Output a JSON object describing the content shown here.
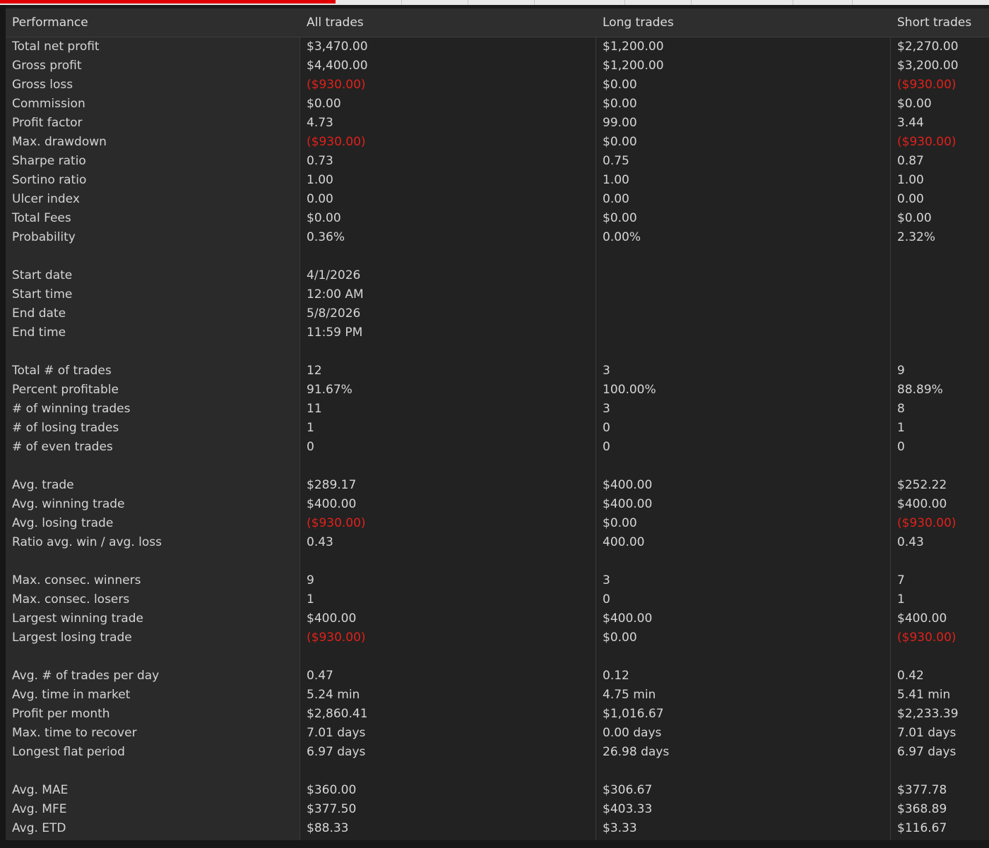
{
  "colors": {
    "background": "#222222",
    "label_column": "#2a2a2a",
    "header": "#2e2e2e",
    "text": "#d6d6d6",
    "negative": "#e0211b",
    "top_accent": "#e00000"
  },
  "header": {
    "label": "Performance",
    "all": "All trades",
    "long": "Long trades",
    "short": "Short trades"
  },
  "rows": [
    {
      "label": "Total net profit",
      "all": "$3,470.00",
      "long": "$1,200.00",
      "short": "$2,270.00"
    },
    {
      "label": "Gross profit",
      "all": "$4,400.00",
      "long": "$1,200.00",
      "short": "$3,200.00"
    },
    {
      "label": "Gross loss",
      "all": "($930.00)",
      "long": "$0.00",
      "short": "($930.00)"
    },
    {
      "label": "Commission",
      "all": "$0.00",
      "long": "$0.00",
      "short": "$0.00"
    },
    {
      "label": "Profit factor",
      "all": "4.73",
      "long": "99.00",
      "short": "3.44"
    },
    {
      "label": "Max. drawdown",
      "all": "($930.00)",
      "long": "$0.00",
      "short": "($930.00)"
    },
    {
      "label": "Sharpe ratio",
      "all": "0.73",
      "long": "0.75",
      "short": "0.87"
    },
    {
      "label": "Sortino ratio",
      "all": "1.00",
      "long": "1.00",
      "short": "1.00"
    },
    {
      "label": "Ulcer index",
      "all": "0.00",
      "long": "0.00",
      "short": "0.00"
    },
    {
      "label": "Total Fees",
      "all": "$0.00",
      "long": "$0.00",
      "short": "$0.00"
    },
    {
      "label": "Probability",
      "all": "0.36%",
      "long": "0.00%",
      "short": "2.32%"
    },
    {
      "gap": true
    },
    {
      "label": "Start date",
      "all": "4/1/2026",
      "long": "",
      "short": ""
    },
    {
      "label": "Start time",
      "all": "12:00 AM",
      "long": "",
      "short": ""
    },
    {
      "label": "End date",
      "all": "5/8/2026",
      "long": "",
      "short": ""
    },
    {
      "label": "End time",
      "all": "11:59 PM",
      "long": "",
      "short": ""
    },
    {
      "gap": true
    },
    {
      "label": "Total # of trades",
      "all": "12",
      "long": "3",
      "short": "9"
    },
    {
      "label": "Percent profitable",
      "all": "91.67%",
      "long": "100.00%",
      "short": "88.89%"
    },
    {
      "label": "# of winning trades",
      "all": "11",
      "long": "3",
      "short": "8"
    },
    {
      "label": "# of losing trades",
      "all": "1",
      "long": "0",
      "short": "1"
    },
    {
      "label": "# of even trades",
      "all": "0",
      "long": "0",
      "short": "0"
    },
    {
      "gap": true
    },
    {
      "label": "Avg. trade",
      "all": "$289.17",
      "long": "$400.00",
      "short": "$252.22"
    },
    {
      "label": "Avg. winning trade",
      "all": "$400.00",
      "long": "$400.00",
      "short": "$400.00"
    },
    {
      "label": "Avg. losing trade",
      "all": "($930.00)",
      "long": "$0.00",
      "short": "($930.00)"
    },
    {
      "label": "Ratio avg. win / avg. loss",
      "all": "0.43",
      "long": "400.00",
      "short": "0.43"
    },
    {
      "gap": true
    },
    {
      "label": "Max. consec. winners",
      "all": "9",
      "long": "3",
      "short": "7"
    },
    {
      "label": "Max. consec. losers",
      "all": "1",
      "long": "0",
      "short": "1"
    },
    {
      "label": "Largest winning trade",
      "all": "$400.00",
      "long": "$400.00",
      "short": "$400.00"
    },
    {
      "label": "Largest losing trade",
      "all": "($930.00)",
      "long": "$0.00",
      "short": "($930.00)"
    },
    {
      "gap": true
    },
    {
      "label": "Avg. # of trades per day",
      "all": "0.47",
      "long": "0.12",
      "short": "0.42"
    },
    {
      "label": "Avg. time in market",
      "all": "5.24 min",
      "long": "4.75 min",
      "short": "5.41 min"
    },
    {
      "label": "Profit per month",
      "all": "$2,860.41",
      "long": "$1,016.67",
      "short": "$2,233.39"
    },
    {
      "label": "Max. time to recover",
      "all": "7.01 days",
      "long": "0.00 days",
      "short": "7.01 days"
    },
    {
      "label": "Longest flat period",
      "all": "6.97 days",
      "long": "26.98 days",
      "short": "6.97 days"
    },
    {
      "gap": true
    },
    {
      "label": "Avg. MAE",
      "all": "$360.00",
      "long": "$306.67",
      "short": "$377.78"
    },
    {
      "label": "Avg. MFE",
      "all": "$377.50",
      "long": "$403.33",
      "short": "$368.89"
    },
    {
      "label": "Avg. ETD",
      "all": "$88.33",
      "long": "$3.33",
      "short": "$116.67"
    }
  ]
}
